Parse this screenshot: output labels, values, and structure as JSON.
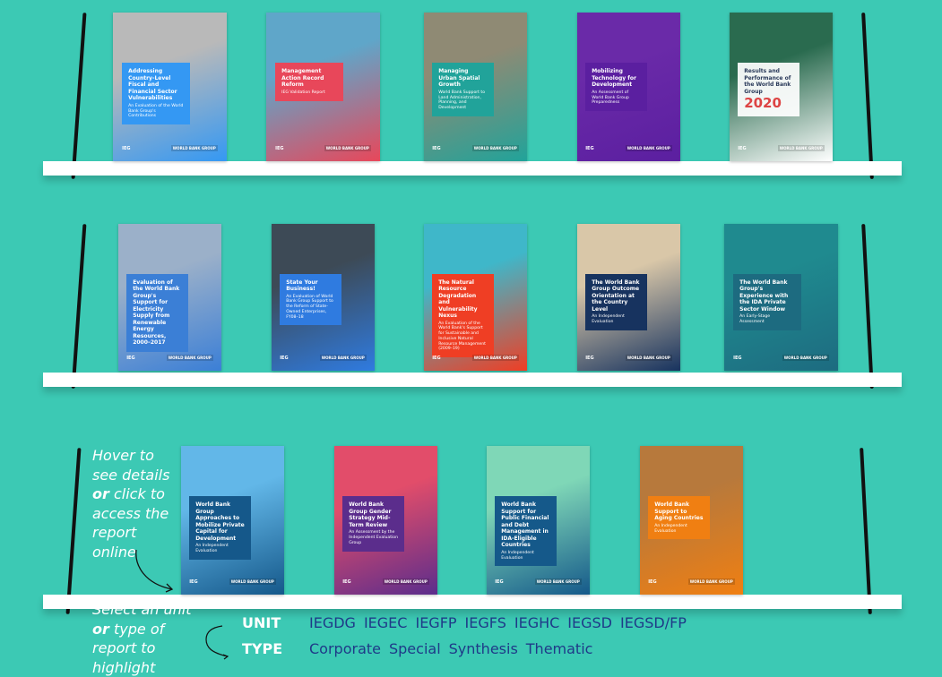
{
  "shelves": [
    {
      "books": [
        {
          "title": "Addressing Country-Level Fiscal and Financial Sector Vulnerabilities",
          "subtitle": "An Evaluation of the World Bank Group's Contributions",
          "colors": [
            "#b9b9b9",
            "#3498f3"
          ]
        },
        {
          "title": "Management Action Record Reform",
          "subtitle": "IEG Validation Report",
          "colors": [
            "#5fa6c9",
            "#e8475a"
          ]
        },
        {
          "title": "Managing Urban Spatial Growth",
          "subtitle": "World Bank Support to Land Administration, Planning, and Development",
          "colors": [
            "#8f8a74",
            "#21a39a"
          ]
        },
        {
          "title": "Mobilizing Technology for Development",
          "subtitle": "An Assessment of World Bank Group Preparedness",
          "colors": [
            "#6a2aa8",
            "#5b1fa0"
          ]
        },
        {
          "title": "Results and Performance of the World Bank Group",
          "subtitle": "2020",
          "colors": [
            "#2a6b4f",
            "#ffffff"
          ]
        }
      ]
    },
    {
      "books": [
        {
          "title": "Evaluation of the World Bank Group's Support for Electricity Supply from Renewable Energy Resources, 2000–2017",
          "subtitle": "",
          "colors": [
            "#9bb0c9",
            "#3b7fd6"
          ]
        },
        {
          "title": "State Your Business!",
          "subtitle": "An Evaluation of World Bank Group Support to the Reform of State-Owned Enterprises, FY08–18",
          "colors": [
            "#3d4a56",
            "#2f7be0"
          ]
        },
        {
          "title": "The Natural Resource Degradation and Vulnerability Nexus",
          "subtitle": "An Evaluation of the World Bank's Support for Sustainable and Inclusive Natural Resource Management (2009–19)",
          "colors": [
            "#3fb7c9",
            "#ef3e24"
          ]
        },
        {
          "title": "The World Bank Group Outcome Orientation at the Country Level",
          "subtitle": "An Independent Evaluation",
          "colors": [
            "#d9c7a8",
            "#17335f"
          ]
        },
        {
          "title": "The World Bank Group's Experience with the IDA Private Sector Window",
          "subtitle": "An Early-Stage Assessment",
          "colors": [
            "#1f8a8f",
            "#1d6b80"
          ]
        }
      ]
    },
    {
      "books": [
        {
          "title": "World Bank Group Approaches to Mobilize Private Capital for Development",
          "subtitle": "An Independent Evaluation",
          "colors": [
            "#62b7e8",
            "#15588a"
          ]
        },
        {
          "title": "World Bank Group Gender Strategy Mid-Term Review",
          "subtitle": "An Assessment by the Independent Evaluation Group",
          "colors": [
            "#e24d6a",
            "#5b2d8c"
          ]
        },
        {
          "title": "World Bank Support for Public Financial and Debt Management in IDA-Eligible Countries",
          "subtitle": "An Independent Evaluation",
          "colors": [
            "#7fd7b7",
            "#15598a"
          ]
        },
        {
          "title": "World Bank Support to Aging Countries",
          "subtitle": "An Independent Evaluation",
          "colors": [
            "#b7793c",
            "#f07f12"
          ]
        }
      ]
    }
  ],
  "footer_badges": {
    "ieg": "IEG",
    "wbg": "WORLD BANK GROUP"
  },
  "hints": {
    "hover_pre": "Hover to see details",
    "hover_or": "or",
    "hover_post": "click to access the report online",
    "select_pre": "Select an unit",
    "select_or": "or",
    "select_post": "type of report to highlight"
  },
  "filters": {
    "unit_label": "UNIT",
    "units": [
      "IEGDG",
      "IEGEC",
      "IEGFP",
      "IEGFS",
      "IEGHC",
      "IEGSD",
      "IEGSD/FP"
    ],
    "type_label": "TYPE",
    "types": [
      "Corporate",
      "Special",
      "Synthesis",
      "Thematic"
    ]
  },
  "colors": {
    "background": "#3cc9b4",
    "accent": "#1f3a88"
  }
}
